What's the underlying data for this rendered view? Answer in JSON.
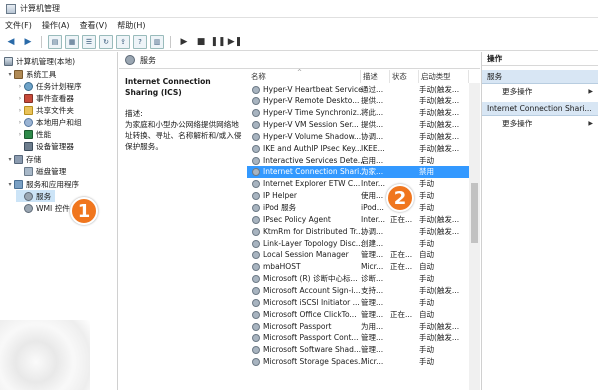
{
  "window": {
    "title": "计算机管理"
  },
  "menu": [
    "文件(F)",
    "操作(A)",
    "查看(V)",
    "帮助(H)"
  ],
  "tree": [
    {
      "label": "计算机管理(本地)",
      "icon": "computer-icon",
      "level": 0,
      "arrow": ""
    },
    {
      "label": "系统工具",
      "icon": "tools-icon",
      "level": 1,
      "arrow": "▾"
    },
    {
      "label": "任务计划程序",
      "icon": "clock-icon",
      "level": 2,
      "arrow": "›"
    },
    {
      "label": "事件查看器",
      "icon": "event-icon",
      "level": 2,
      "arrow": "›"
    },
    {
      "label": "共享文件夹",
      "icon": "folder-icon",
      "level": 2,
      "arrow": "›"
    },
    {
      "label": "本地用户和组",
      "icon": "users-icon",
      "level": 2,
      "arrow": "›"
    },
    {
      "label": "性能",
      "icon": "perf-icon",
      "level": 2,
      "arrow": "›"
    },
    {
      "label": "设备管理器",
      "icon": "device-icon",
      "level": 2,
      "arrow": ""
    },
    {
      "label": "存储",
      "icon": "storage-icon",
      "level": 1,
      "arrow": "▾"
    },
    {
      "label": "磁盘管理",
      "icon": "disk-icon",
      "level": 2,
      "arrow": ""
    },
    {
      "label": "服务和应用程序",
      "icon": "svc-icon",
      "level": 1,
      "arrow": "▾"
    },
    {
      "label": "服务",
      "icon": "gear-icon",
      "level": 2,
      "arrow": "",
      "selected": true
    },
    {
      "label": "WMI 控件",
      "icon": "gear-icon",
      "level": 2,
      "arrow": ""
    }
  ],
  "middle": {
    "header": "服务",
    "desc_title": "Internet Connection Sharing (ICS)",
    "desc_label": "描述:",
    "desc_text": "为家庭和小型办公网络提供网络地址转换、寻址、名称解析和/或入侵保护服务。"
  },
  "columns": {
    "name": "名称",
    "desc": "描述",
    "status": "状态",
    "start": "启动类型"
  },
  "services": [
    {
      "name": "Hyper-V Heartbeat Service",
      "desc": "通过...",
      "status": "",
      "start": "手动(触发..."
    },
    {
      "name": "Hyper-V Remote Deskto...",
      "desc": "提供...",
      "status": "",
      "start": "手动(触发..."
    },
    {
      "name": "Hyper-V Time Synchroniz...",
      "desc": "将此...",
      "status": "",
      "start": "手动(触发..."
    },
    {
      "name": "Hyper-V VM Session Ser...",
      "desc": "提供...",
      "status": "",
      "start": "手动(触发..."
    },
    {
      "name": "Hyper-V Volume Shadow...",
      "desc": "协调...",
      "status": "",
      "start": "手动(触发..."
    },
    {
      "name": "IKE and AuthIP IPsec Key...",
      "desc": "IKEE...",
      "status": "",
      "start": "手动(触发..."
    },
    {
      "name": "Interactive Services Dete...",
      "desc": "启用...",
      "status": "",
      "start": "手动"
    },
    {
      "name": "Internet Connection Shari...",
      "desc": "为家...",
      "status": "",
      "start": "禁用",
      "selected": true
    },
    {
      "name": "Internet Explorer ETW C...",
      "desc": "Inter...",
      "status": "",
      "start": "手动"
    },
    {
      "name": "IP Helper",
      "desc": "使用...",
      "status": "",
      "start": "手动"
    },
    {
      "name": "iPod 服务",
      "desc": "iPod...",
      "status": "",
      "start": "手动"
    },
    {
      "name": "IPsec Policy Agent",
      "desc": "Inter...",
      "status": "正在...",
      "start": "手动(触发..."
    },
    {
      "name": "KtmRm for Distributed Tr...",
      "desc": "协调...",
      "status": "",
      "start": "手动(触发..."
    },
    {
      "name": "Link-Layer Topology Disc...",
      "desc": "创建...",
      "status": "",
      "start": "手动"
    },
    {
      "name": "Local Session Manager",
      "desc": "管理...",
      "status": "正在...",
      "start": "自动"
    },
    {
      "name": "mbaHOST",
      "desc": "Micr...",
      "status": "正在...",
      "start": "自动"
    },
    {
      "name": "Microsoft (R) 诊断中心标...",
      "desc": "诊断...",
      "status": "",
      "start": "手动"
    },
    {
      "name": "Microsoft Account Sign-i...",
      "desc": "支持...",
      "status": "",
      "start": "手动(触发..."
    },
    {
      "name": "Microsoft iSCSI Initiator ...",
      "desc": "管理...",
      "status": "",
      "start": "手动"
    },
    {
      "name": "Microsoft Office ClickTo...",
      "desc": "管理...",
      "status": "正在...",
      "start": "自动"
    },
    {
      "name": "Microsoft Passport",
      "desc": "为用...",
      "status": "",
      "start": "手动(触发..."
    },
    {
      "name": "Microsoft Passport Cont...",
      "desc": "管理...",
      "status": "",
      "start": "手动(触发..."
    },
    {
      "name": "Microsoft Software Shad...",
      "desc": "管理...",
      "status": "",
      "start": "手动"
    },
    {
      "name": "Microsoft Storage Spaces...",
      "desc": "Micr...",
      "status": "",
      "start": "手动"
    }
  ],
  "actions": {
    "header": "操作",
    "section1": "服务",
    "item1": "更多操作",
    "section2": "Internet Connection Shari...",
    "item2": "更多操作"
  },
  "callouts": {
    "one": "1",
    "two": "2"
  },
  "colors": {
    "selection": "#3399ff",
    "callout": "#f0761e",
    "tree_selection": "#cce4f7"
  }
}
